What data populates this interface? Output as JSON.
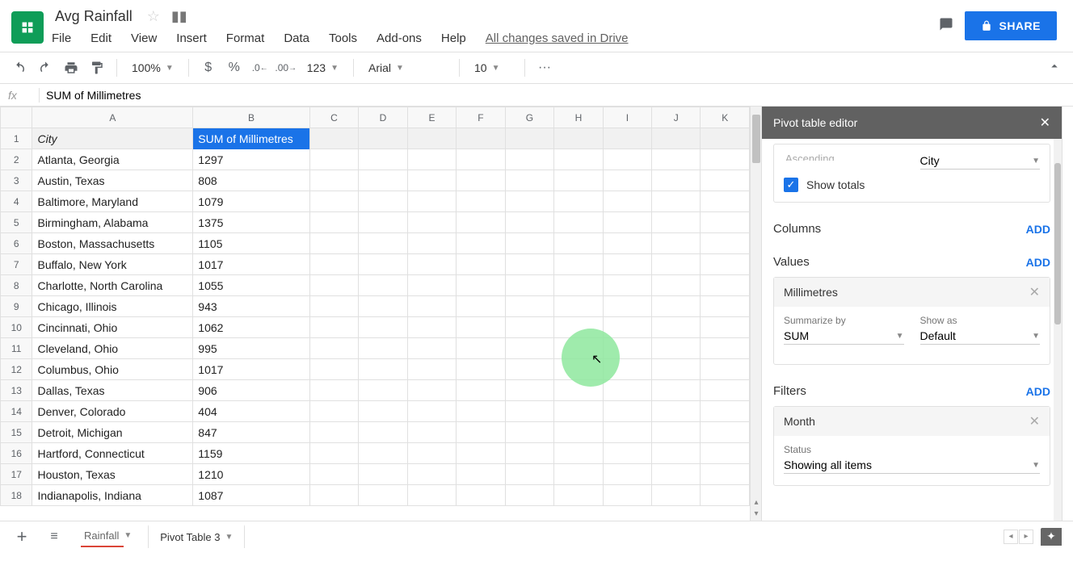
{
  "doc": {
    "title": "Avg Rainfall",
    "save_status": "All changes saved in Drive"
  },
  "menus": {
    "file": "File",
    "edit": "Edit",
    "view": "View",
    "insert": "Insert",
    "format": "Format",
    "data": "Data",
    "tools": "Tools",
    "addons": "Add-ons",
    "help": "Help"
  },
  "share_button": "SHARE",
  "toolbar": {
    "zoom": "100%",
    "currency": "$",
    "percent": "%",
    "dec_dec": ".0",
    "inc_dec": ".00",
    "numfmt": "123",
    "font": "Arial",
    "fontsize": "10",
    "more": "···"
  },
  "formula_bar": {
    "value": "SUM of Millimetres"
  },
  "columns": [
    "A",
    "B",
    "C",
    "D",
    "E",
    "F",
    "G",
    "H",
    "I",
    "J",
    "K"
  ],
  "header_row": {
    "A": "City",
    "B": "SUM of Millimetres"
  },
  "rows": [
    {
      "n": "2",
      "city": "Atlanta, Georgia",
      "val": "1297"
    },
    {
      "n": "3",
      "city": "Austin, Texas",
      "val": "808"
    },
    {
      "n": "4",
      "city": "Baltimore, Maryland",
      "val": "1079"
    },
    {
      "n": "5",
      "city": "Birmingham, Alabama",
      "val": "1375"
    },
    {
      "n": "6",
      "city": "Boston, Massachusetts",
      "val": "1105"
    },
    {
      "n": "7",
      "city": "Buffalo, New York",
      "val": "1017"
    },
    {
      "n": "8",
      "city": "Charlotte, North Carolina",
      "val": "1055"
    },
    {
      "n": "9",
      "city": "Chicago, Illinois",
      "val": "943"
    },
    {
      "n": "10",
      "city": "Cincinnati, Ohio",
      "val": "1062"
    },
    {
      "n": "11",
      "city": "Cleveland, Ohio",
      "val": "995"
    },
    {
      "n": "12",
      "city": "Columbus, Ohio",
      "val": "1017"
    },
    {
      "n": "13",
      "city": "Dallas, Texas",
      "val": "906"
    },
    {
      "n": "14",
      "city": "Denver, Colorado",
      "val": "404"
    },
    {
      "n": "15",
      "city": "Detroit, Michigan",
      "val": "847"
    },
    {
      "n": "16",
      "city": "Hartford, Connecticut",
      "val": "1159"
    },
    {
      "n": "17",
      "city": "Houston, Texas",
      "val": "1210"
    },
    {
      "n": "18",
      "city": "Indianapolis, Indiana",
      "val": "1087"
    }
  ],
  "sidebar": {
    "title": "Pivot table editor",
    "partial_top": {
      "order": "Ascending",
      "sortby": "City"
    },
    "show_totals": "Show totals",
    "columns": {
      "label": "Columns",
      "add": "ADD"
    },
    "values": {
      "label": "Values",
      "add": "ADD",
      "chip": "Millimetres",
      "summarize_lbl": "Summarize by",
      "summarize": "SUM",
      "showas_lbl": "Show as",
      "showas": "Default"
    },
    "filters": {
      "label": "Filters",
      "add": "ADD",
      "chip": "Month",
      "status_lbl": "Status",
      "status": "Showing all items"
    }
  },
  "tabs": {
    "sheet1": "Rainfall",
    "sheet2": "Pivot Table 3"
  }
}
